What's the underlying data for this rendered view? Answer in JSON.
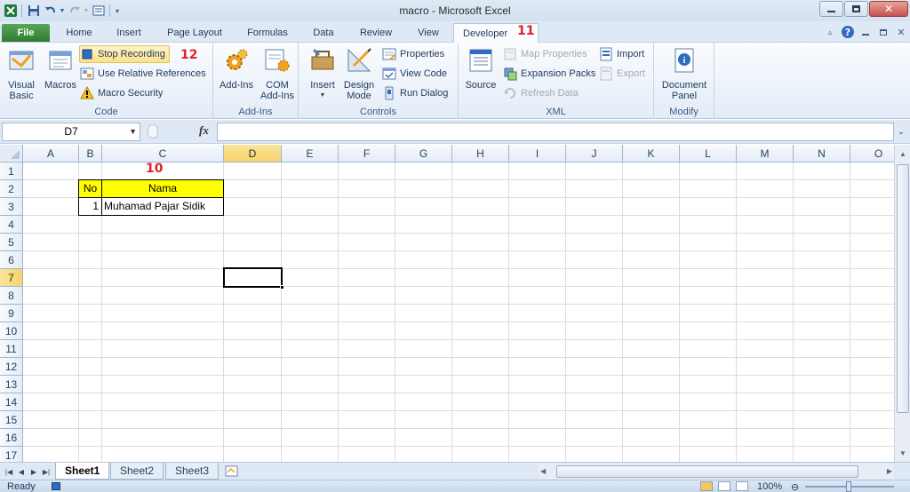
{
  "window": {
    "title": "macro  -  Microsoft Excel"
  },
  "qat": {
    "icons": [
      "excel-logo-icon",
      "save-icon",
      "undo-icon",
      "redo-icon",
      "customize-icon"
    ]
  },
  "tabs": {
    "file": "File",
    "items": [
      "Home",
      "Insert",
      "Page Layout",
      "Formulas",
      "Data",
      "Review",
      "View",
      "Developer"
    ],
    "active": "Developer"
  },
  "ribbon": {
    "code": {
      "label": "Code",
      "visual_basic": "Visual\nBasic",
      "macros": "Macros",
      "stop_recording": "Stop Recording",
      "use_relative": "Use Relative References",
      "macro_security": "Macro Security"
    },
    "addins": {
      "label": "Add-Ins",
      "addins": "Add-Ins",
      "com_addins": "COM\nAdd-Ins"
    },
    "controls": {
      "label": "Controls",
      "insert": "Insert",
      "design_mode": "Design\nMode",
      "properties": "Properties",
      "view_code": "View Code",
      "run_dialog": "Run Dialog"
    },
    "xml": {
      "label": "XML",
      "source": "Source",
      "map_properties": "Map Properties",
      "expansion_packs": "Expansion Packs",
      "refresh_data": "Refresh Data",
      "import": "Import",
      "export": "Export"
    },
    "modify": {
      "label": "Modify",
      "document_panel": "Document\nPanel"
    }
  },
  "annotations": {
    "stop_recording_num": "12",
    "developer_num": "11",
    "cell_num": "10"
  },
  "formula_bar": {
    "name_box": "D7",
    "fx": "fx",
    "value": ""
  },
  "grid": {
    "columns": [
      "A",
      "B",
      "C",
      "D",
      "E",
      "F",
      "G",
      "H",
      "I",
      "J",
      "K",
      "L",
      "M",
      "N",
      "O"
    ],
    "rows": [
      "1",
      "2",
      "3",
      "4",
      "5",
      "6",
      "7",
      "8",
      "9",
      "10",
      "11",
      "12",
      "13",
      "14",
      "15",
      "16",
      "17"
    ],
    "selected_column": "D",
    "selected_row": "7",
    "cells": {
      "B2": "No",
      "C2": "Nama",
      "B3": "1",
      "C3": "Muhamad Pajar Sidik"
    },
    "highlight_color": "#ffff00"
  },
  "sheets": {
    "tabs": [
      "Sheet1",
      "Sheet2",
      "Sheet3"
    ],
    "active": "Sheet1"
  },
  "status": {
    "ready": "Ready",
    "zoom": "100%"
  }
}
